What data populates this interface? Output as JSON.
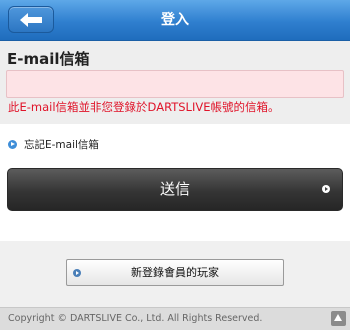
{
  "header": {
    "title": "登入",
    "back_icon": "back-arrow-icon"
  },
  "form": {
    "email_label": "E-mail信箱",
    "email_value": "",
    "error_message": "此E-mail信箱並非您登錄於DARTSLIVE帳號的信箱。"
  },
  "links": {
    "forgot_email": "忘記E-mail信箱"
  },
  "buttons": {
    "submit": "送信",
    "register": "新登錄會員的玩家"
  },
  "footer": {
    "copyright": "Copyright © DARTSLIVE Co., Ltd. All Rights Reserved."
  },
  "colors": {
    "header_blue": "#2f7fcf",
    "error_red": "#e0142a",
    "input_bg": "#fde3e6"
  }
}
